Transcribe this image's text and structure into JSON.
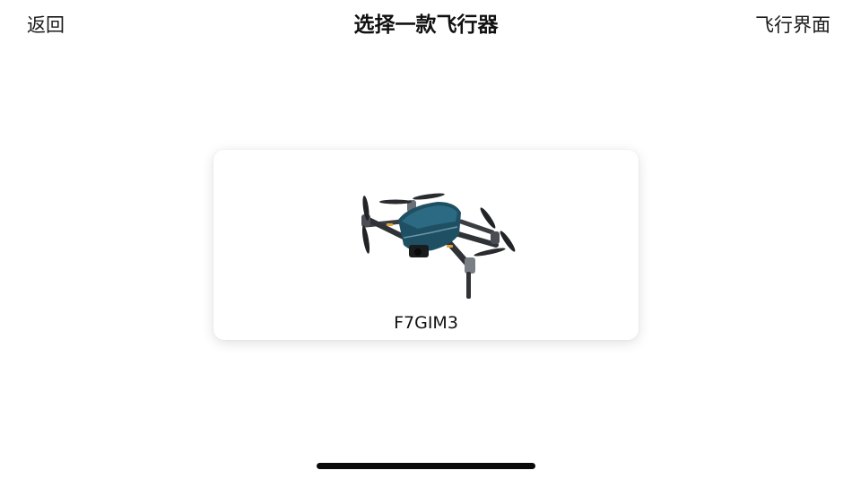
{
  "nav": {
    "back_label": "返回",
    "title": "选择一款飞行器",
    "right_label": "飞行界面"
  },
  "aircraft_list": [
    {
      "name": "F7GIM3",
      "image": "drone-image"
    }
  ],
  "colors": {
    "background": "#ffffff",
    "text": "#111111",
    "drone_body": "#1f4f63",
    "home_indicator": "#0a0a0a"
  }
}
